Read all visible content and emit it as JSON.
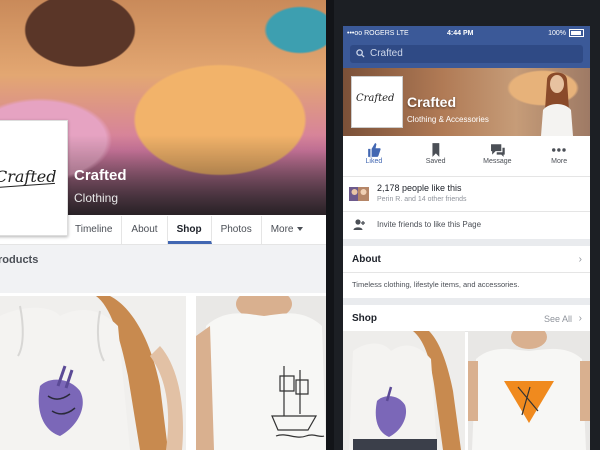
{
  "desktop": {
    "page_name": "Crafted",
    "category": "Clothing",
    "logo_text": "Crafted",
    "tabs": [
      {
        "label": "Timeline"
      },
      {
        "label": "About"
      },
      {
        "label": "Shop"
      },
      {
        "label": "Photos"
      },
      {
        "label": "More"
      }
    ],
    "active_tab": "Shop",
    "section_title": "roducts"
  },
  "mobile": {
    "status": {
      "carrier": "•••oo ROGERS  LTE",
      "time": "4:44 PM",
      "battery": "100%"
    },
    "search": {
      "placeholder": "Crafted"
    },
    "page_name": "Crafted",
    "category": "Clothing & Accessories",
    "logo_text": "Crafted",
    "actions": [
      {
        "label": "Liked",
        "icon": "thumbs-up-icon"
      },
      {
        "label": "Saved",
        "icon": "bookmark-icon"
      },
      {
        "label": "Message",
        "icon": "chat-icon"
      },
      {
        "label": "More",
        "icon": "more-dots-icon"
      }
    ],
    "likes": {
      "main": "2,178 people like this",
      "sub": "Perin R. and 14 other friends"
    },
    "invite": "Invite friends to like this Page",
    "about": {
      "title": "About",
      "text": "Timeless clothing, lifestyle items, and accessories."
    },
    "shop": {
      "title": "Shop",
      "see_all": "See All"
    }
  },
  "colors": {
    "facebook_blue": "#3b5998",
    "link_blue": "#4267b2"
  }
}
